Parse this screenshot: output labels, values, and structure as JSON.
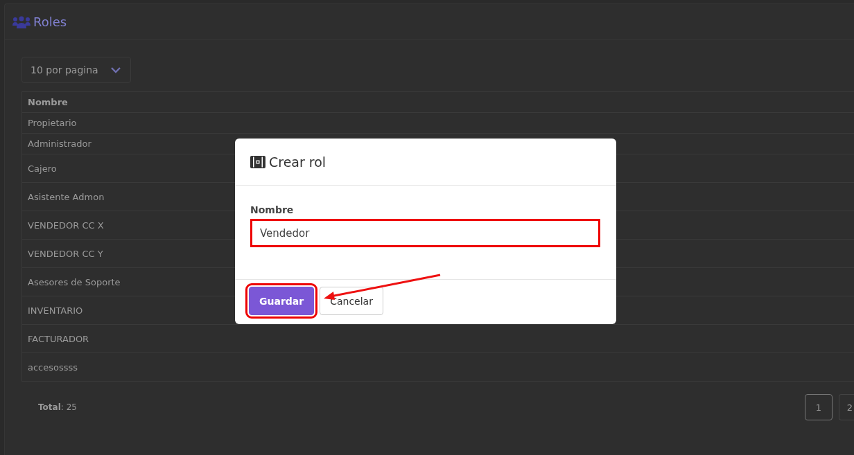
{
  "page": {
    "title": "Roles",
    "page_size_select": {
      "value": "10 por pagina"
    },
    "table": {
      "columns": [
        "Nombre"
      ],
      "rows": [
        {
          "name": "Propietario"
        },
        {
          "name": "Administrador"
        },
        {
          "name": "Cajero"
        },
        {
          "name": "Asistente Admon"
        },
        {
          "name": "VENDEDOR CC X"
        },
        {
          "name": "VENDEDOR CC Y"
        },
        {
          "name": "Asesores de Soporte"
        },
        {
          "name": "INVENTARIO"
        },
        {
          "name": "FACTURADOR"
        },
        {
          "name": "accesossss"
        }
      ]
    },
    "total": {
      "label": "Total",
      "value": ": 25"
    },
    "pagination": [
      {
        "label": "1",
        "selected": true
      },
      {
        "label": "2",
        "selected": false
      }
    ]
  },
  "modal": {
    "title": "Crear rol",
    "field": {
      "label": "Nombre",
      "value": "Vendedor",
      "highlighted": true
    },
    "buttons": [
      {
        "label": "Guardar",
        "kind": "primary",
        "highlighted": true
      },
      {
        "label": "Cancelar",
        "kind": "secondary",
        "highlighted": false
      }
    ],
    "annotation_arrow": true
  }
}
